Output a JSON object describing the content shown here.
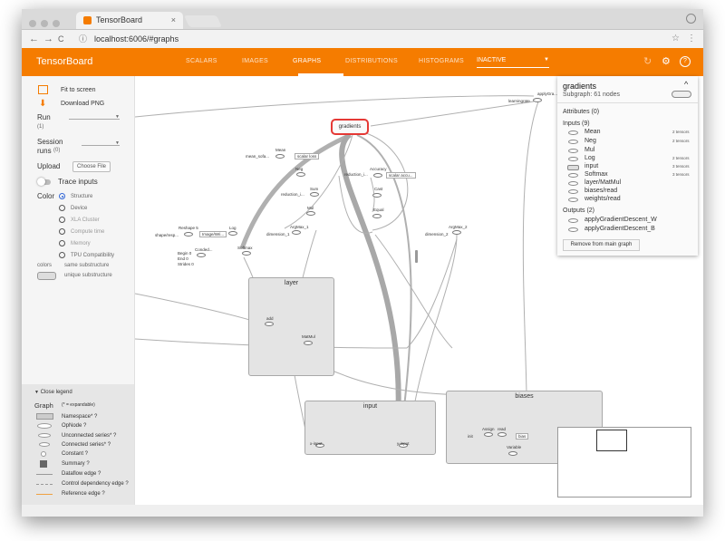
{
  "browser": {
    "tab_title": "TensorBoard",
    "tab_close": "×",
    "url": "localhost:6006/#graphs",
    "back_glyph": "←",
    "forward_glyph": "→",
    "reload_glyph": "C",
    "info_glyph": "ⓘ",
    "star_glyph": "☆",
    "menu_glyph": "⋮"
  },
  "header": {
    "brand": "TensorBoard",
    "tabs": [
      {
        "label": "SCALARS"
      },
      {
        "label": "IMAGES"
      },
      {
        "label": "GRAPHS",
        "active": true
      },
      {
        "label": "DISTRIBUTIONS"
      },
      {
        "label": "HISTOGRAMS"
      }
    ],
    "inactive_label": "INACTIVE",
    "inactive_caret": "▼",
    "refresh_icon": "↻",
    "settings_icon": "⚙",
    "help_icon": "?",
    "accent": "#f57c00"
  },
  "sidebar": {
    "fit_label": "Fit to screen",
    "download_label": "Download PNG",
    "run_label": "Run",
    "run_count": "(1)",
    "session_label": "Session",
    "session_label2": "runs",
    "session_count": "(0)",
    "upload_label": "Upload",
    "choose_file": "Choose File",
    "trace_label": "Trace inputs",
    "color_label": "Color",
    "color_options": [
      {
        "label": "Structure",
        "selected": true
      },
      {
        "label": "Device"
      },
      {
        "label": "XLA Cluster"
      },
      {
        "label": "Compute time"
      },
      {
        "label": "Memory"
      },
      {
        "label": "TPU Compatibility"
      }
    ],
    "colors_label": "colors",
    "same_sub": "same substructure",
    "unique_sub": "unique substructure"
  },
  "legend": {
    "close_label": "Close legend",
    "graph_label": "Graph",
    "expandable_note": "(* = expandable)",
    "items": [
      {
        "label": "Namespace* ?"
      },
      {
        "label": "OpNode ?"
      },
      {
        "label": "Unconnected series* ?"
      },
      {
        "label": "Connected series* ?"
      },
      {
        "label": "Constant ?"
      },
      {
        "label": "Summary ?"
      },
      {
        "label": "Dataflow edge ?"
      },
      {
        "label": "Control dependency edge ?"
      },
      {
        "label": "Reference edge ?"
      }
    ]
  },
  "graph": {
    "selected_node": "gradients",
    "groups": [
      {
        "label": "layer"
      },
      {
        "label": "input"
      },
      {
        "label": "biases"
      }
    ],
    "nodes": [
      {
        "label": "applyGra..."
      },
      {
        "label": "learningrate"
      },
      {
        "label": "Mean"
      },
      {
        "label": "mean_sofa..."
      },
      {
        "label": "scalar loss"
      },
      {
        "label": "Neg"
      },
      {
        "label": "Sum"
      },
      {
        "label": "reduction_i..."
      },
      {
        "label": "Mul"
      },
      {
        "label": "Accuracy"
      },
      {
        "label": "reduction_i..."
      },
      {
        "label": "scalar accu..."
      },
      {
        "label": "Cast"
      },
      {
        "label": "Equal"
      },
      {
        "label": "ArgMax_1"
      },
      {
        "label": "dimension_1"
      },
      {
        "label": "ArgMax_2"
      },
      {
        "label": "dimension_2"
      },
      {
        "label": "Reshape 5"
      },
      {
        "label": "shape/resp..."
      },
      {
        "label": "Image/Wri..."
      },
      {
        "label": "Log"
      },
      {
        "label": "Softmax"
      },
      {
        "label": "Conded..."
      },
      {
        "label": "Begin 0"
      },
      {
        "label": "End 0"
      },
      {
        "label": "Strides 0"
      },
      {
        "label": "add"
      },
      {
        "label": "MatMul"
      },
      {
        "label": "x-input"
      },
      {
        "label": "y-input"
      },
      {
        "label": "Assign"
      },
      {
        "label": "read"
      },
      {
        "label": "init"
      },
      {
        "label": "Variable"
      },
      {
        "label": "bias"
      }
    ]
  },
  "info_panel": {
    "title": "gradients",
    "subtitle": "Subgraph: 61 nodes",
    "collapse_icon": "^",
    "attributes_label": "Attributes (0)",
    "inputs_label": "Inputs (9)",
    "inputs": [
      {
        "name": "Mean",
        "tensors": "2 tensors"
      },
      {
        "name": "Neg",
        "tensors": "2 tensors"
      },
      {
        "name": "Mul",
        "tensors": ""
      },
      {
        "name": "Log",
        "tensors": "2 tensors"
      },
      {
        "name": "input",
        "tensors": "3 tensors"
      },
      {
        "name": "Softmax",
        "tensors": "3 tensors"
      },
      {
        "name": "layer/MatMul",
        "tensors": ""
      },
      {
        "name": "biases/read",
        "tensors": ""
      },
      {
        "name": "weights/read",
        "tensors": ""
      }
    ],
    "outputs_label": "Outputs (2)",
    "outputs": [
      {
        "name": "applyGradientDescent_W"
      },
      {
        "name": "applyGradientDescent_B"
      }
    ],
    "remove_label": "Remove from main graph"
  }
}
